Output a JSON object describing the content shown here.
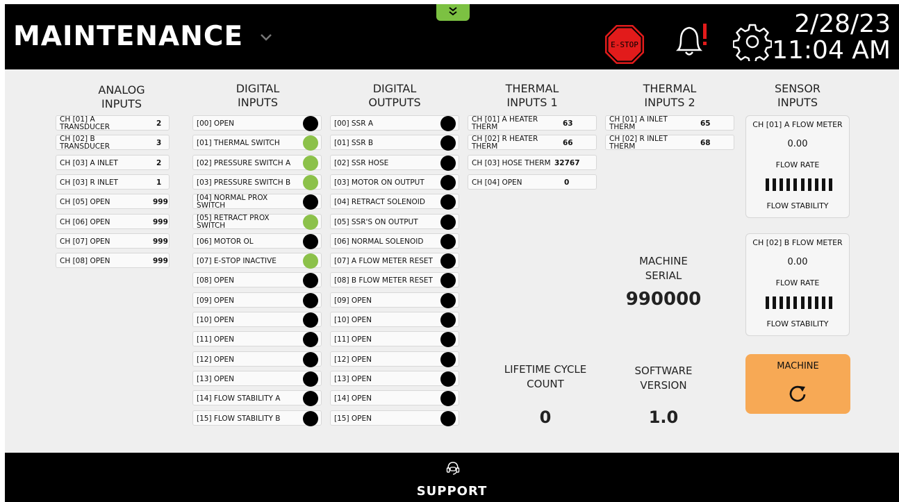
{
  "header": {
    "title": "MAINTENANCE",
    "estop_label": "E-STOP",
    "date": "2/28/23",
    "time": "11:04 AM",
    "brand_green": "#7cc142",
    "estop_red": "#e21b1b",
    "alert_red": "#e21b1b"
  },
  "columns": {
    "analog": "ANALOG\nINPUTS",
    "digital_in": "DIGITAL\nINPUTS",
    "digital_out": "DIGITAL\nOUTPUTS",
    "thermal1": "THERMAL\nINPUTS 1",
    "thermal2": "THERMAL\nINPUTS 2",
    "sensor": "SENSOR\nINPUTS"
  },
  "analog_inputs": [
    {
      "label": "CH [01] A TRANSDUCER",
      "value": "2"
    },
    {
      "label": "CH [02] B TRANSDUCER",
      "value": "3"
    },
    {
      "label": "CH [03] A INLET",
      "value": "2"
    },
    {
      "label": "CH [03] R INLET",
      "value": "1"
    },
    {
      "label": "CH [05] OPEN",
      "value": "999"
    },
    {
      "label": "CH [06] OPEN",
      "value": "999"
    },
    {
      "label": "CH [07] OPEN",
      "value": "999"
    },
    {
      "label": "CH [08] OPEN",
      "value": "999"
    }
  ],
  "digital_inputs": [
    {
      "label": "[00] OPEN",
      "state": "off"
    },
    {
      "label": "[01] THERMAL SWITCH",
      "state": "on"
    },
    {
      "label": "[02] PRESSURE SWITCH A",
      "state": "on"
    },
    {
      "label": "[03] PRESSURE SWITCH B",
      "state": "on"
    },
    {
      "label": "[04] NORMAL PROX SWITCH",
      "state": "off"
    },
    {
      "label": "[05] RETRACT PROX SWITCH",
      "state": "on"
    },
    {
      "label": "[06] MOTOR OL",
      "state": "off"
    },
    {
      "label": "[07] E-STOP  INACTIVE",
      "state": "on"
    },
    {
      "label": "[08] OPEN",
      "state": "off"
    },
    {
      "label": "[09] OPEN",
      "state": "off"
    },
    {
      "label": "[10] OPEN",
      "state": "off"
    },
    {
      "label": "[11] OPEN",
      "state": "off"
    },
    {
      "label": "[12] OPEN",
      "state": "off"
    },
    {
      "label": "[13] OPEN",
      "state": "off"
    },
    {
      "label": "[14] FLOW STABILITY A",
      "state": "off"
    },
    {
      "label": "[15] FLOW STABILITY B",
      "state": "off"
    }
  ],
  "digital_outputs": [
    {
      "label": "[00] SSR A",
      "state": "off"
    },
    {
      "label": "[01] SSR B",
      "state": "off"
    },
    {
      "label": "[02] SSR HOSE",
      "state": "off"
    },
    {
      "label": "[03] MOTOR ON OUTPUT",
      "state": "off"
    },
    {
      "label": "[04] RETRACT SOLENOID",
      "state": "off"
    },
    {
      "label": "[05] SSR'S ON OUTPUT",
      "state": "off"
    },
    {
      "label": "[06] NORMAL SOLENOID",
      "state": "off"
    },
    {
      "label": "[07] A FLOW METER RESET",
      "state": "off"
    },
    {
      "label": "[08] B FLOW METER RESET",
      "state": "off"
    },
    {
      "label": "[09] OPEN",
      "state": "off"
    },
    {
      "label": "[10] OPEN",
      "state": "off"
    },
    {
      "label": "[11] OPEN",
      "state": "off"
    },
    {
      "label": "[12] OPEN",
      "state": "off"
    },
    {
      "label": "[13] OPEN",
      "state": "off"
    },
    {
      "label": "[14] OPEN",
      "state": "off"
    },
    {
      "label": "[15] OPEN",
      "state": "off"
    }
  ],
  "thermal_inputs_1": [
    {
      "label": "CH [01] A HEATER THERM",
      "value": "63"
    },
    {
      "label": "CH [02] R HEATER THERM",
      "value": "66"
    },
    {
      "label": "CH [03] HOSE THERM",
      "value": "32767"
    },
    {
      "label": "CH [04] OPEN",
      "value": "0"
    }
  ],
  "thermal_inputs_2": [
    {
      "label": "CH [01] A INLET THERM",
      "value": "65"
    },
    {
      "label": "CH [02] R INLET THERM",
      "value": "68"
    }
  ],
  "sensor_inputs": [
    {
      "title": "CH [01] A FLOW METER",
      "rate": "0.00",
      "rate_label": "FLOW RATE",
      "stability_label": "FLOW STABILITY"
    },
    {
      "title": "CH [02] B FLOW METER",
      "rate": "0.00",
      "rate_label": "FLOW RATE",
      "stability_label": "FLOW STABILITY"
    }
  ],
  "machine_serial": {
    "label": "MACHINE\nSERIAL",
    "value": "990000"
  },
  "lifetime_cycle": {
    "label": "LIFETIME CYCLE\nCOUNT",
    "value": "0"
  },
  "software_version": {
    "label": "SOFTWARE\nVERSION",
    "value": "1.0"
  },
  "machine_button": {
    "label": "MACHINE",
    "icon": "refresh-icon",
    "color": "#f7a955"
  },
  "footer": {
    "support_label": "SUPPORT",
    "icon": "support-headset-icon"
  },
  "indicator_colors": {
    "on": "#8cc14a",
    "off": "#000000"
  }
}
